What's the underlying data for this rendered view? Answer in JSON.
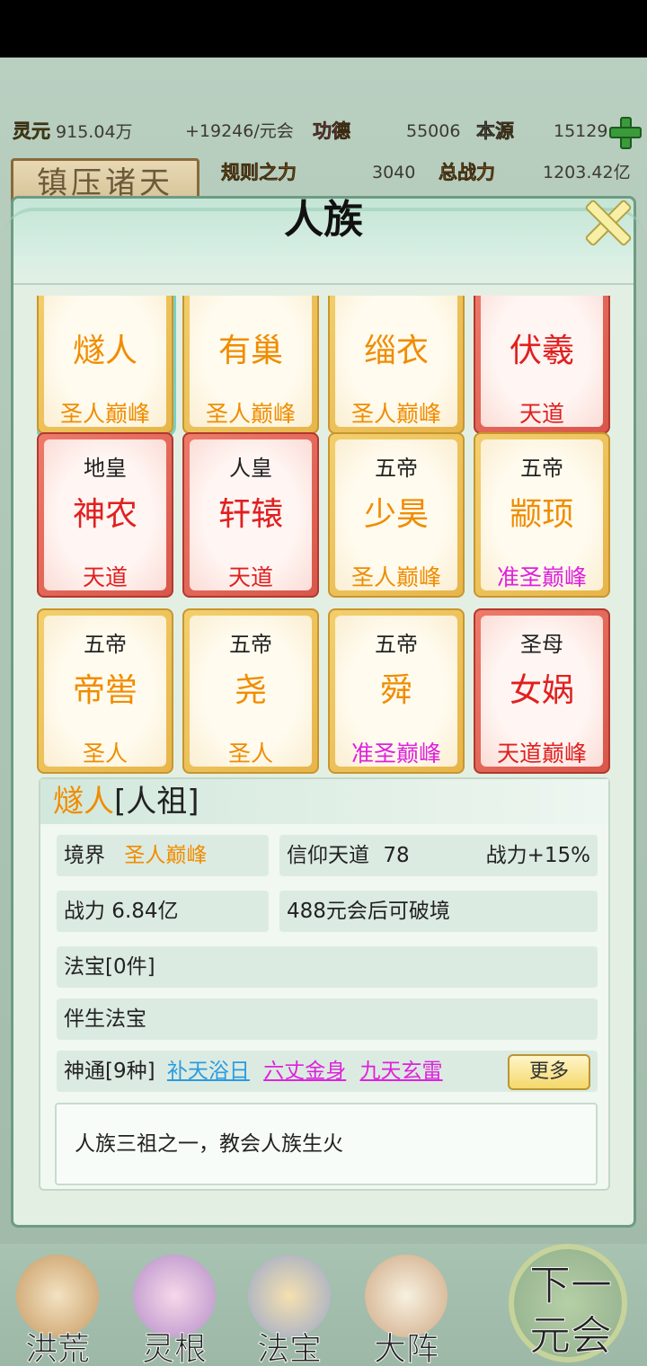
{
  "resources": {
    "lingyuan_label": "灵元",
    "lingyuan_value": "915.04万",
    "lingyuan_rate": "+19246/元会",
    "gongde_label": "功德",
    "gongde_value": "55006",
    "benyuan_label": "本源",
    "benyuan_value": "15129",
    "guize_label": "规则之力",
    "guize_value": "3040",
    "zongzhanli_label": "总战力",
    "zongzhanli_value": "1203.42亿"
  },
  "banner_left": "镇压诸天",
  "modal": {
    "title": "人族"
  },
  "cards": [
    {
      "sub": "",
      "name": "燧人",
      "rank": "圣人巅峰",
      "frame": "gold",
      "name_color": "orange",
      "rank_color": "orange",
      "selected": true
    },
    {
      "sub": "",
      "name": "有巢",
      "rank": "圣人巅峰",
      "frame": "gold",
      "name_color": "orange",
      "rank_color": "orange"
    },
    {
      "sub": "",
      "name": "缁衣",
      "rank": "圣人巅峰",
      "frame": "gold",
      "name_color": "orange",
      "rank_color": "orange"
    },
    {
      "sub": "",
      "name": "伏羲",
      "rank": "天道",
      "frame": "red",
      "name_color": "red",
      "rank_color": "red"
    },
    {
      "sub": "地皇",
      "name": "神农",
      "rank": "天道",
      "frame": "red",
      "name_color": "red",
      "rank_color": "red"
    },
    {
      "sub": "人皇",
      "name": "轩辕",
      "rank": "天道",
      "frame": "red",
      "name_color": "red",
      "rank_color": "red"
    },
    {
      "sub": "五帝",
      "name": "少昊",
      "rank": "圣人巅峰",
      "frame": "gold",
      "name_color": "orange",
      "rank_color": "orange"
    },
    {
      "sub": "五帝",
      "name": "颛顼",
      "rank": "准圣巅峰",
      "frame": "gold",
      "name_color": "orange",
      "rank_color": "magenta"
    },
    {
      "sub": "五帝",
      "name": "帝喾",
      "rank": "圣人",
      "frame": "gold",
      "name_color": "orange",
      "rank_color": "orange"
    },
    {
      "sub": "五帝",
      "name": "尧",
      "rank": "圣人",
      "frame": "gold",
      "name_color": "orange",
      "rank_color": "orange"
    },
    {
      "sub": "五帝",
      "name": "舜",
      "rank": "准圣巅峰",
      "frame": "gold",
      "name_color": "orange",
      "rank_color": "magenta"
    },
    {
      "sub": "圣母",
      "name": "女娲",
      "rank": "天道巅峰",
      "frame": "red",
      "name_color": "red",
      "rank_color": "red"
    }
  ],
  "detail": {
    "name": "燧人",
    "title_suffix": "[人祖]",
    "realm_label": "境界",
    "realm_value": "圣人巅峰",
    "faith_label": "信仰天道",
    "faith_value": "78",
    "faith_bonus": "战力+15%",
    "power": "战力 6.84亿",
    "breakthrough": "488元会后可破境",
    "treasure": "法宝[0件]",
    "companion": "伴生法宝",
    "skills_label": "神通[9种]",
    "skills": [
      "补天浴日",
      "六丈金身",
      "九天玄雷"
    ],
    "more_button": "更多",
    "description": "人族三祖之一，教会人族生火"
  },
  "nav": {
    "items": [
      {
        "label": "洪荒",
        "icon": "mountain-icon"
      },
      {
        "label": "灵根",
        "icon": "lotus-icon"
      },
      {
        "label": "法宝",
        "icon": "treasure-icon"
      },
      {
        "label": "大阵",
        "icon": "formation-icon"
      }
    ],
    "next_line1": "下一",
    "next_line2": "元会"
  },
  "colors": {
    "orange": "#f08c00",
    "red": "#e02020",
    "magenta": "#dd22dd",
    "skill_blue": "#2b9be0"
  }
}
